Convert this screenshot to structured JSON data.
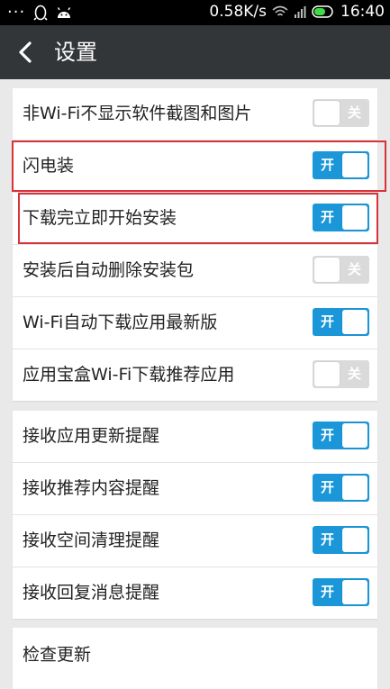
{
  "status_bar": {
    "network_speed": "0.58K/s",
    "time": "16:40",
    "icons": [
      "more-dots-icon",
      "qq-penguin-icon",
      "android-icon",
      "wifi-icon",
      "signal-icon",
      "battery-icon"
    ]
  },
  "header": {
    "title": "设置",
    "back_icon": "chevron-left-icon"
  },
  "colors": {
    "toggle_on": "#1a96d9",
    "toggle_off": "#dadada",
    "highlight": "#d8333a",
    "appbar": "#333639"
  },
  "sections": [
    {
      "items": [
        {
          "label": "非Wi-Fi不显示软件截图和图片",
          "state": "关",
          "on": false
        },
        {
          "label": "闪电装",
          "state": "开",
          "on": true
        },
        {
          "label": "下载完立即开始安装",
          "state": "开",
          "on": true
        },
        {
          "label": "安装后自动删除安装包",
          "state": "关",
          "on": false
        },
        {
          "label": "Wi-Fi自动下载应用最新版",
          "state": "开",
          "on": true
        },
        {
          "label": "应用宝盒Wi-Fi下载推荐应用",
          "state": "关",
          "on": false
        }
      ]
    },
    {
      "items": [
        {
          "label": "接收应用更新提醒",
          "state": "开",
          "on": true
        },
        {
          "label": "接收推荐内容提醒",
          "state": "开",
          "on": true
        },
        {
          "label": "接收空间清理提醒",
          "state": "开",
          "on": true
        },
        {
          "label": "接收回复消息提醒",
          "state": "开",
          "on": true
        }
      ]
    },
    {
      "items": [
        {
          "label": "检查更新"
        }
      ]
    }
  ]
}
